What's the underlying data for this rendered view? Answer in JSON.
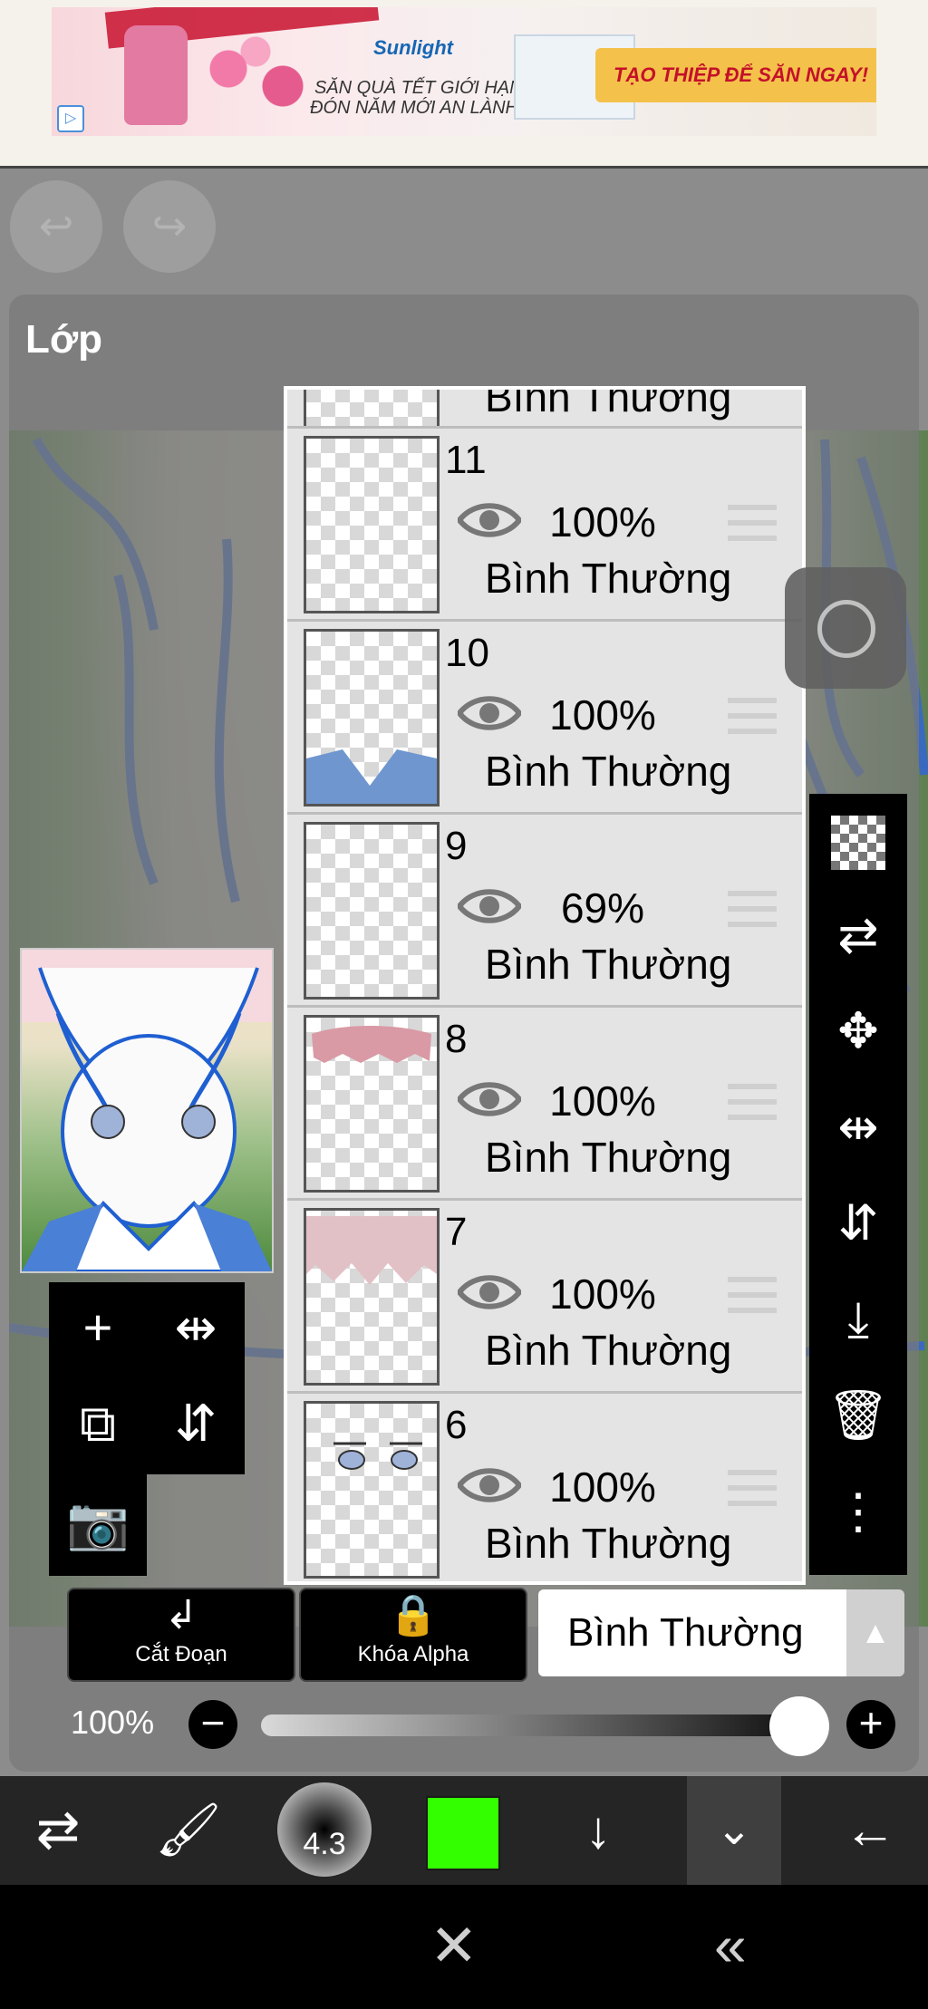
{
  "ad": {
    "logo": "Sunlight",
    "line1": "SĂN QUÀ TẾT GIỚI HẠN",
    "line2": "ĐÓN NĂM MỚI AN LÀNH",
    "cta": "TẠO THIỆP ĐỂ SĂN NGAY!"
  },
  "history": {
    "undo_icon": "undo-icon",
    "redo_icon": "redo-icon"
  },
  "panel": {
    "title": "Lớp"
  },
  "layers": [
    {
      "number": "",
      "opacity": "",
      "blend": "Bình Thường"
    },
    {
      "number": "11",
      "opacity": "100%",
      "blend": "Bình Thường"
    },
    {
      "number": "10",
      "opacity": "100%",
      "blend": "Bình Thường"
    },
    {
      "number": "9",
      "opacity": "69%",
      "blend": "Bình Thường"
    },
    {
      "number": "8",
      "opacity": "100%",
      "blend": "Bình Thường"
    },
    {
      "number": "7",
      "opacity": "100%",
      "blend": "Bình Thường"
    },
    {
      "number": "6",
      "opacity": "100%",
      "blend": "Bình Thường"
    }
  ],
  "actions": {
    "clip_label": "Cắt Đoạn",
    "alpha_lock_label": "Khóa Alpha",
    "blend_mode_value": "Bình Thường"
  },
  "layer_opacity": {
    "label": "100%",
    "value": 1.0
  },
  "toolbar": {
    "brush_size": "4.3",
    "color": "#33ff00"
  },
  "colors": {
    "panel_bg": "#777777",
    "toolbar_bg": "#252525",
    "accent_color": "#33ff00"
  }
}
